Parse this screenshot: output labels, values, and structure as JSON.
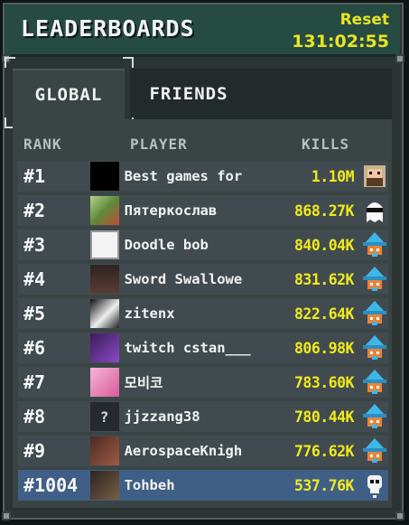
{
  "header": {
    "title": "LEADERBOARDS",
    "reset_label": "Reset",
    "reset_time": "131:02:55"
  },
  "tabs": [
    {
      "label": "GLOBAL",
      "active": true
    },
    {
      "label": "FRIENDS",
      "active": false
    }
  ],
  "columns": {
    "rank": "RANK",
    "player": "PLAYER",
    "kills": "KILLS"
  },
  "rows": [
    {
      "rank": "#1",
      "player": "Best games for",
      "kills": "1.10M",
      "avatar": "black",
      "mascot": "bearded-man-icon"
    },
    {
      "rank": "#2",
      "player": "Пятеркослав",
      "kills": "868.27K",
      "avatar": "green",
      "mascot": "ghost-sunglasses-icon"
    },
    {
      "rank": "#3",
      "player": "Doodle bob",
      "kills": "840.04K",
      "avatar": "sketch",
      "mascot": "fox-wizard-icon"
    },
    {
      "rank": "#4",
      "player": "Sword Swallowe",
      "kills": "831.62K",
      "avatar": "dark",
      "mascot": "fox-wizard-icon"
    },
    {
      "rank": "#5",
      "player": "zitenx",
      "kills": "822.64K",
      "avatar": "mono",
      "mascot": "fox-wizard-icon"
    },
    {
      "rank": "#6",
      "player": "twitch cstan___",
      "kills": "806.98K",
      "avatar": "purple",
      "mascot": "fox-wizard-icon"
    },
    {
      "rank": "#7",
      "player": "모비코",
      "kills": "783.60K",
      "avatar": "pink",
      "mascot": "fox-wizard-icon"
    },
    {
      "rank": "#8",
      "player": "jjzzang38",
      "kills": "780.44K",
      "avatar": "unknown",
      "avatar_glyph": "?",
      "mascot": "fox-wizard-icon"
    },
    {
      "rank": "#9",
      "player": "AerospaceKnigh",
      "kills": "776.62K",
      "avatar": "brown",
      "mascot": "fox-wizard-icon"
    },
    {
      "rank": "#1004",
      "player": "Tohbeh",
      "kills": "537.76K",
      "avatar": "armor",
      "mascot": "skull-icon",
      "is_me": true
    }
  ]
}
